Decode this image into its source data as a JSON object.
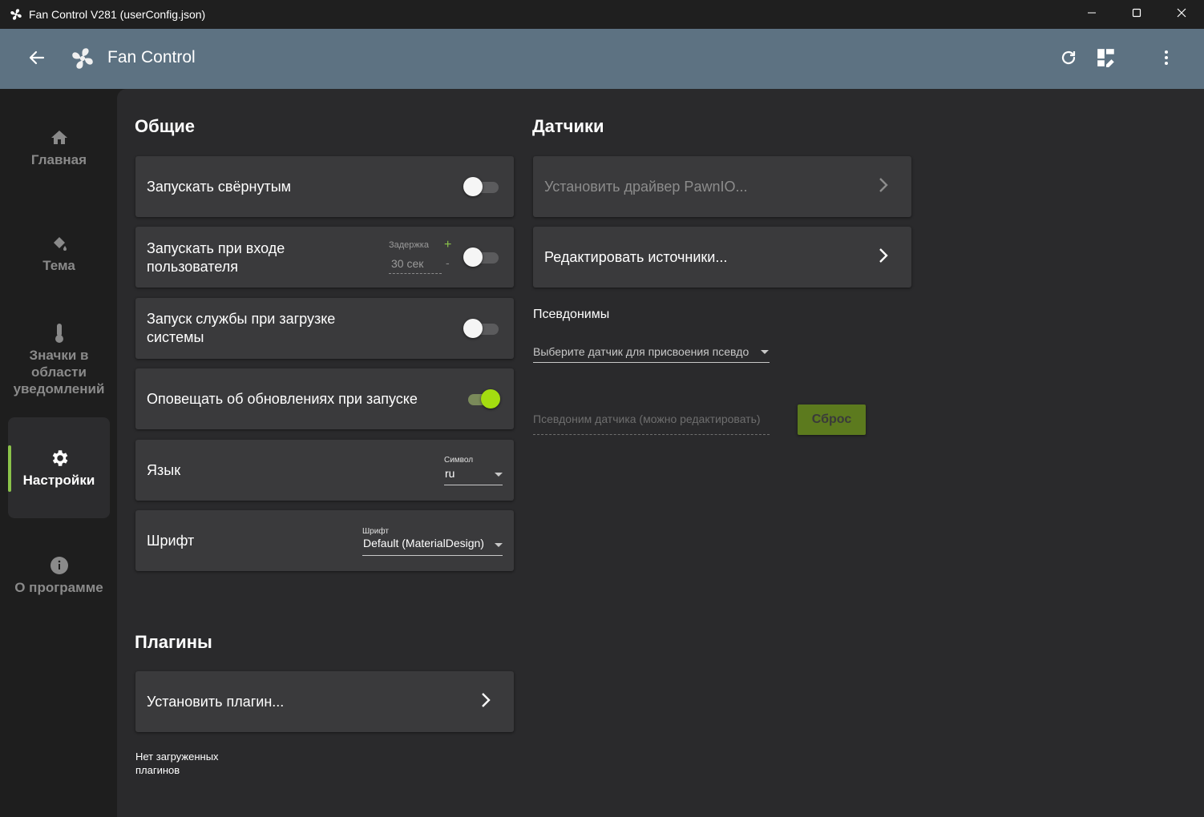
{
  "window": {
    "title": "Fan Control V281 (userConfig.json)",
    "icons": {
      "app": "fan-icon",
      "minimize": "minimize-icon",
      "maximize": "maximize-icon",
      "close": "close-icon"
    }
  },
  "appbar": {
    "title": "Fan Control",
    "icons": {
      "back": "arrow-left-icon",
      "logo": "fan-icon",
      "refresh": "refresh-icon",
      "dashboard": "dashboard-edit-icon",
      "menu": "more-vertical-icon"
    }
  },
  "sidebar": {
    "items": [
      {
        "label": "Главная",
        "icon": "home-icon",
        "active": false
      },
      {
        "label": "Тема",
        "icon": "paint-bucket-icon",
        "active": false
      },
      {
        "label": "Значки в области уведомлений",
        "icon": "thermometer-icon",
        "active": false
      },
      {
        "label": "Настройки",
        "icon": "gear-icon",
        "active": true
      },
      {
        "label": "О программе",
        "icon": "info-icon",
        "active": false
      }
    ],
    "accent_color": "#8bc34a"
  },
  "general": {
    "title": "Общие",
    "start_minimized": {
      "label": "Запускать свёрнутым",
      "enabled": false
    },
    "start_on_login": {
      "label": "Запускать при входе пользователя",
      "enabled": false,
      "delay_label": "Задержка",
      "delay_value": "30 сек",
      "plus": "+",
      "minus": "-"
    },
    "service_on_boot": {
      "label": "Запуск службы при загрузке системы",
      "enabled": false
    },
    "notify_updates": {
      "label": "Оповещать об обновлениях при запуске",
      "enabled": true
    },
    "language": {
      "label": "Язык",
      "field_label": "Символ",
      "value": "ru"
    },
    "font": {
      "label": "Шрифт",
      "field_label": "Шрифт",
      "value": "Default (MaterialDesign)"
    }
  },
  "plugins": {
    "title": "Плагины",
    "install_label": "Установить плагин...",
    "empty_text": "Нет загруженных плагинов"
  },
  "sensors": {
    "title": "Датчики",
    "install_driver_label": "Установить драйвер PawnIO...",
    "edit_sources_label": "Редактировать источники...",
    "aliases_title": "Псевдонимы",
    "sensor_select_placeholder": "Выберите датчик для присвоения псевдо",
    "alias_input_placeholder": "Псевдоним датчика (можно редактировать)",
    "reset_label": "Сброс"
  }
}
